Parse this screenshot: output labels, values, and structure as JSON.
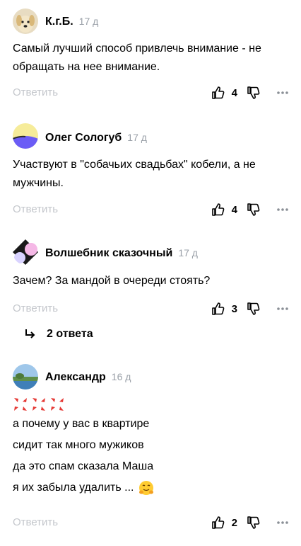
{
  "comments": [
    {
      "author": "К.г.Б.",
      "time": "17 д",
      "text": "Самый лучший способ привлечь внимание - не обращать на нее внимание.",
      "reply_label": "Ответить",
      "likes": "4",
      "avatar": "dog-photo"
    },
    {
      "author": "Олег Сологуб",
      "time": "17 д",
      "text": "Участвуют в \"собачьих свадьбах\" кобели, а не мужчины.",
      "reply_label": "Ответить",
      "likes": "4",
      "avatar": "yellow-purple-abstract"
    },
    {
      "author": "Волшебник сказочный",
      "time": "17 д",
      "text": "Зачем? За мандой в очереди стоять?",
      "reply_label": "Ответить",
      "likes": "3",
      "avatar": "black-pink-abstract",
      "thread_label": "2 ответа"
    },
    {
      "author": "Александр",
      "time": "16 д",
      "lines": [
        "а почему у вас в квартире",
        "сидит так много мужиков",
        "да это спам сказала Маша",
        "я их забыла удалить ..."
      ],
      "reply_label": "Ответить",
      "likes": "2",
      "avatar": "landscape-photo",
      "emojis": [
        "anger-symbol",
        "anger-symbol",
        "anger-symbol",
        "hugging-face"
      ]
    }
  ],
  "icons": {
    "like": "thumbs-up-icon",
    "dislike": "thumbs-down-icon",
    "more": "more-dots-icon",
    "thread": "reply-arrow-icon"
  },
  "colors": {
    "muted": "#c4c7cc",
    "time": "#9aa0a8",
    "anger": "#e53935"
  }
}
